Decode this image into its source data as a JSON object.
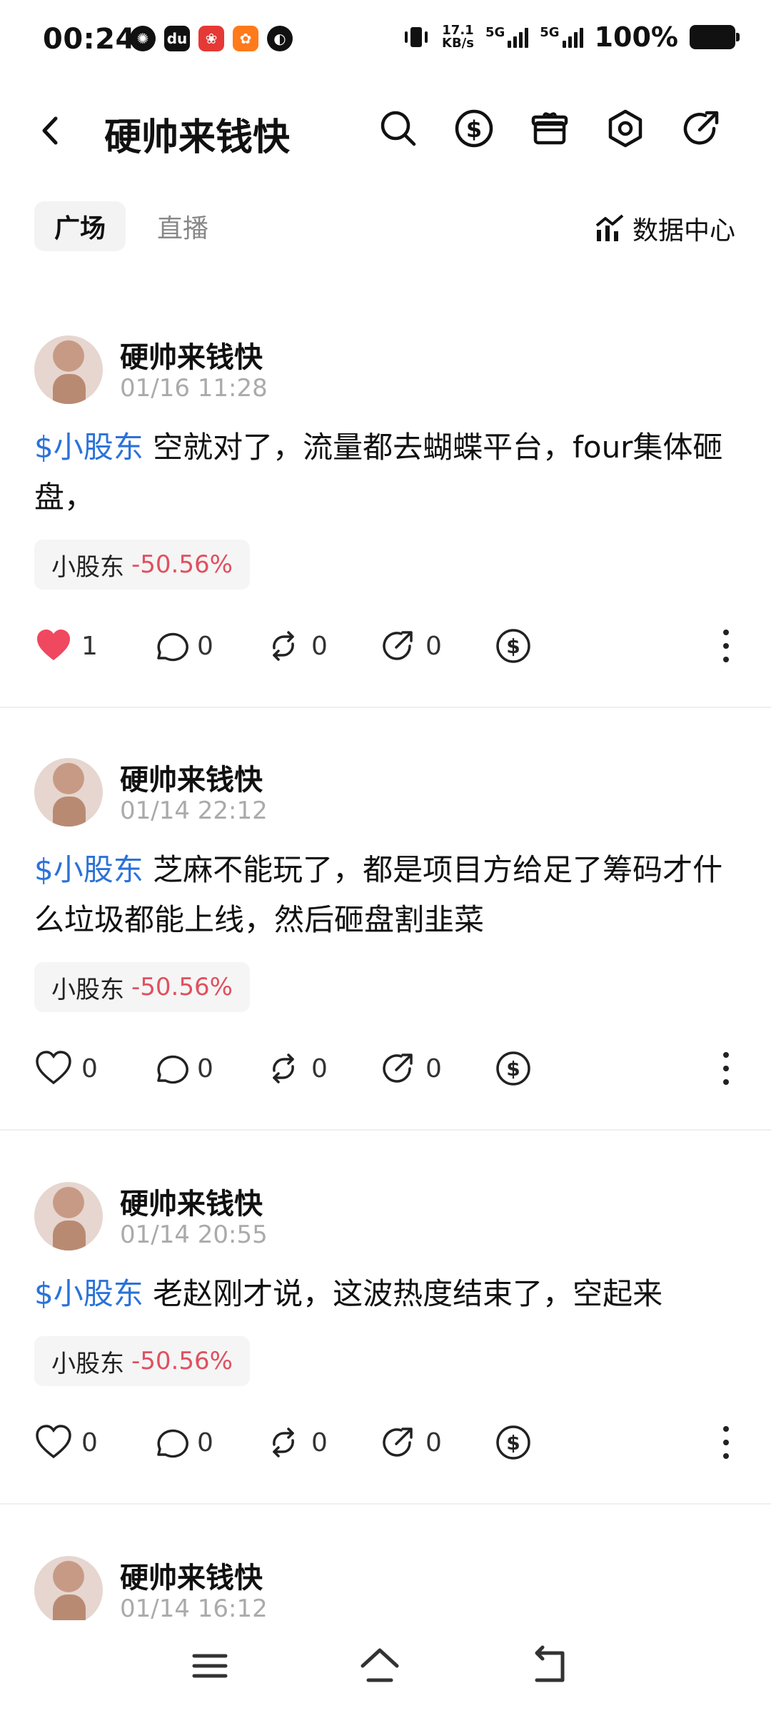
{
  "status_bar": {
    "time": "00:24",
    "speed_value": "17.1",
    "speed_unit": "KB/s",
    "net1": "5G",
    "net2": "5G",
    "battery": "100%"
  },
  "header": {
    "title": "硬帅来钱快"
  },
  "tabs": {
    "active": "广场",
    "inactive": "直播",
    "data_center": "数据中心"
  },
  "posts": [
    {
      "author": "硬帅来钱快",
      "time": "01/16 11:28",
      "tag": "$小股东",
      "text": " 空就对了，流量都去蝴蝶平台，four集体砸盘，",
      "chip_name": "小股东",
      "chip_pct": "-50.56%",
      "likes": "1",
      "comments": "0",
      "reposts": "0",
      "shares": "0",
      "liked": true
    },
    {
      "author": "硬帅来钱快",
      "time": "01/14 22:12",
      "tag": "$小股东",
      "text": " 芝麻不能玩了，都是项目方给足了筹码才什么垃圾都能上线，然后砸盘割韭菜",
      "chip_name": "小股东",
      "chip_pct": "-50.56%",
      "likes": "0",
      "comments": "0",
      "reposts": "0",
      "shares": "0",
      "liked": false
    },
    {
      "author": "硬帅来钱快",
      "time": "01/14 20:55",
      "tag": "$小股东",
      "text": " 老赵刚才说，这波热度结束了，空起来",
      "chip_name": "小股东",
      "chip_pct": "-50.56%",
      "likes": "0",
      "comments": "0",
      "reposts": "0",
      "shares": "0",
      "liked": false
    },
    {
      "author": "硬帅来钱快",
      "time": "01/14 16:12"
    }
  ]
}
